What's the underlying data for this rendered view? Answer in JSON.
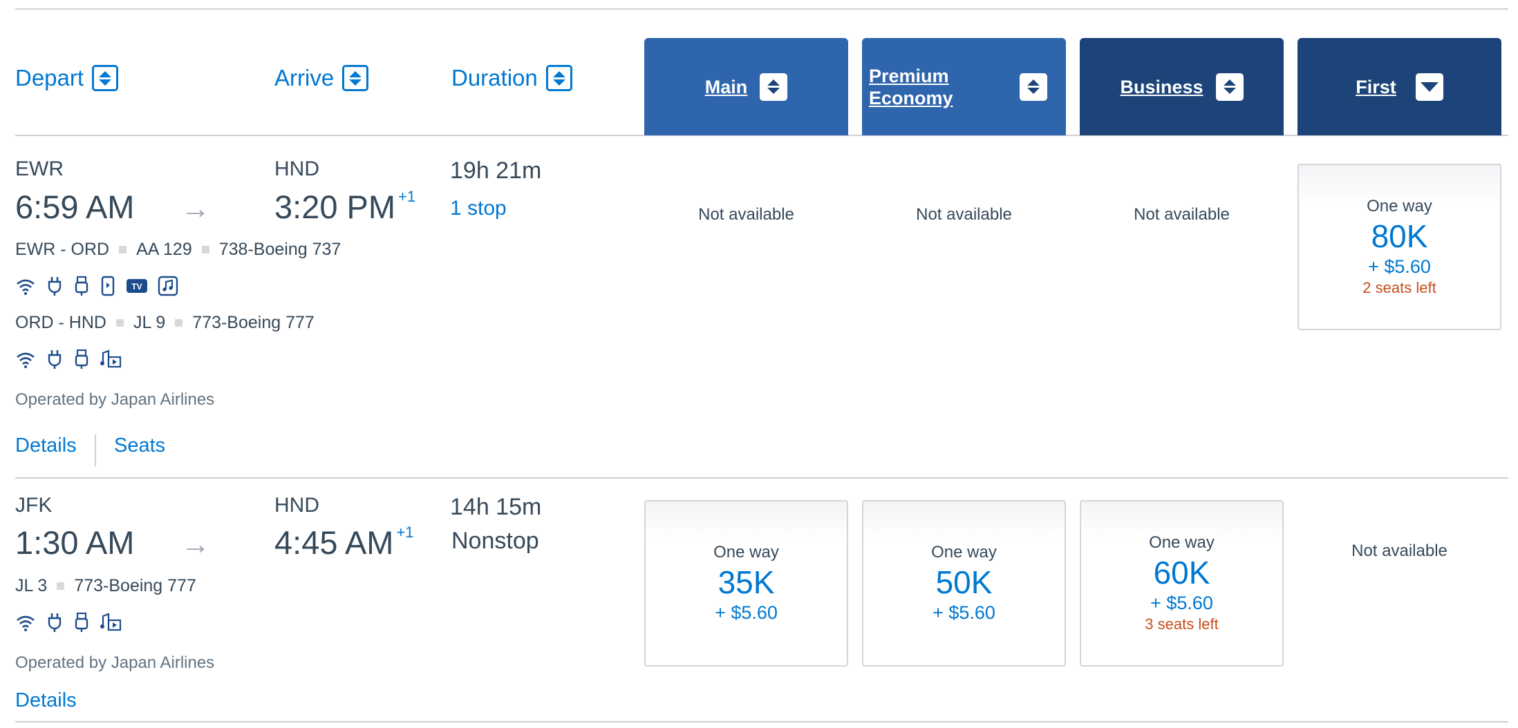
{
  "header": {
    "sort_depart": "Depart",
    "sort_arrive": "Arrive",
    "sort_duration": "Duration",
    "cabins": [
      "Main",
      "Premium Economy",
      "Business",
      "First"
    ],
    "colors": {
      "cabin_light": "#2e65ad",
      "cabin_dark": "#1d4479",
      "link": "#0078d2",
      "seats_left": "#c84d18"
    }
  },
  "flights": [
    {
      "origin": "EWR",
      "depart_time": "6:59 AM",
      "destination": "HND",
      "arrive_time": "3:20 PM",
      "day_offset": "+1",
      "duration": "19h 21m",
      "stops": "1 stop",
      "segments": [
        {
          "route": "EWR - ORD",
          "flight": "AA 129",
          "aircraft": "738-Boeing 737",
          "amenities": [
            "wifi-icon",
            "power-outlet-icon",
            "usb-icon",
            "phone-entertainment-icon",
            "tv-icon",
            "audio-icon"
          ]
        },
        {
          "route": "ORD - HND",
          "flight": "JL 9",
          "aircraft": "773-Boeing 777",
          "amenities": [
            "wifi-icon",
            "power-outlet-icon",
            "usb-icon",
            "on-demand-entertainment-icon"
          ]
        }
      ],
      "operated_by": "Operated by Japan Airlines",
      "links": {
        "details": "Details",
        "seats": "Seats"
      },
      "fares": [
        {
          "cabin": "Main",
          "available": false,
          "text": "Not available"
        },
        {
          "cabin": "Premium Economy",
          "available": false,
          "text": "Not available"
        },
        {
          "cabin": "Business",
          "available": false,
          "text": "Not available"
        },
        {
          "cabin": "First",
          "available": true,
          "label": "One way",
          "miles": "80K",
          "tax": "+ $5.60",
          "seats_left": "2 seats left"
        }
      ]
    },
    {
      "origin": "JFK",
      "depart_time": "1:30 AM",
      "destination": "HND",
      "arrive_time": "4:45 AM",
      "day_offset": "+1",
      "duration": "14h 15m",
      "stops": "Nonstop",
      "segments": [
        {
          "flight": "JL 3",
          "aircraft": "773-Boeing 777",
          "amenities": [
            "wifi-icon",
            "power-outlet-icon",
            "usb-icon",
            "on-demand-entertainment-icon"
          ]
        }
      ],
      "operated_by": "Operated by Japan Airlines",
      "links": {
        "details": "Details"
      },
      "fares": [
        {
          "cabin": "Main",
          "available": true,
          "label": "One way",
          "miles": "35K",
          "tax": "+ $5.60"
        },
        {
          "cabin": "Premium Economy",
          "available": true,
          "label": "One way",
          "miles": "50K",
          "tax": "+ $5.60"
        },
        {
          "cabin": "Business",
          "available": true,
          "label": "One way",
          "miles": "60K",
          "tax": "+ $5.60",
          "seats_left": "3 seats left"
        },
        {
          "cabin": "First",
          "available": false,
          "text": "Not available"
        }
      ]
    }
  ]
}
